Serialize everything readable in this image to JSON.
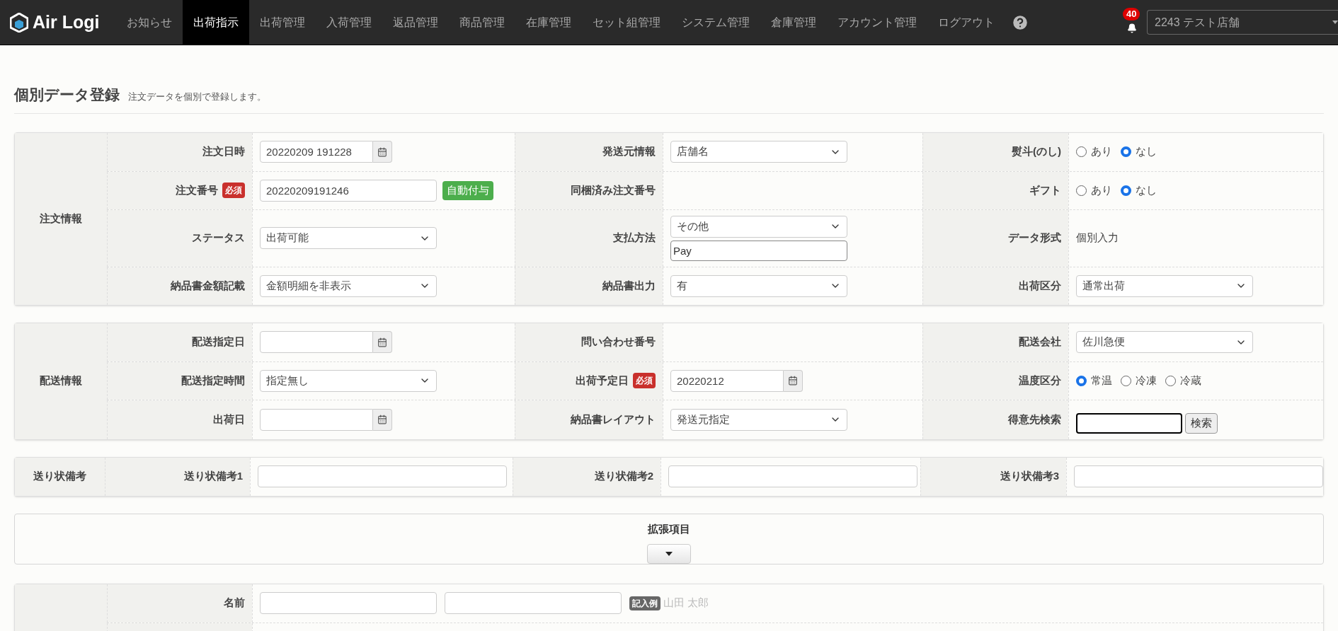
{
  "header": {
    "logo": "Air Logi",
    "nav": [
      {
        "label": "お知らせ",
        "selected": false
      },
      {
        "label": "出荷指示",
        "selected": true
      },
      {
        "label": "出荷管理",
        "selected": false
      },
      {
        "label": "入荷管理",
        "selected": false
      },
      {
        "label": "返品管理",
        "selected": false
      },
      {
        "label": "商品管理",
        "selected": false
      },
      {
        "label": "在庫管理",
        "selected": false
      },
      {
        "label": "セット組管理",
        "selected": false
      },
      {
        "label": "システム管理",
        "selected": false
      },
      {
        "label": "倉庫管理",
        "selected": false
      },
      {
        "label": "アカウント管理",
        "selected": false
      },
      {
        "label": "ログアウト",
        "selected": false
      }
    ],
    "notification_count": "40",
    "store": "2243 テスト店舗"
  },
  "page": {
    "title": "個別データ登録",
    "subtitle": "注文データを個別で登録します。"
  },
  "sections": [
    {
      "kind": "grid",
      "label": "注文情報",
      "rows": [
        {
          "fields": [
            {
              "label": "注文日時",
              "control": {
                "kind": "date",
                "value": "20220209 191228"
              }
            },
            {
              "label": "発送元情報",
              "control": {
                "kind": "select",
                "value": "店舗名"
              }
            },
            {
              "label": "熨斗(のし)",
              "control": {
                "kind": "radio",
                "options": [
                  {
                    "label": "あり",
                    "selected": false
                  },
                  {
                    "label": "なし",
                    "selected": true
                  }
                ]
              }
            }
          ]
        },
        {
          "fields": [
            {
              "label": "注文番号",
              "badge": "必須",
              "control": {
                "kind": "text",
                "value": "20220209191246",
                "button": "自動付与"
              }
            },
            {
              "label": "同梱済み注文番号",
              "control": {
                "kind": "none"
              }
            },
            {
              "label": "ギフト",
              "control": {
                "kind": "radio",
                "options": [
                  {
                    "label": "あり",
                    "selected": false
                  },
                  {
                    "label": "なし",
                    "selected": true
                  }
                ]
              }
            }
          ]
        },
        {
          "fields": [
            {
              "label": "ステータス",
              "control": {
                "kind": "select",
                "value": "出荷可能"
              }
            },
            {
              "label": "支払方法",
              "control": {
                "kind": "select_text",
                "value": "その他",
                "text": "Pay"
              }
            },
            {
              "label": "データ形式",
              "control": {
                "kind": "static",
                "value": "個別入力"
              }
            }
          ]
        },
        {
          "fields": [
            {
              "label": "納品書金額記載",
              "control": {
                "kind": "select",
                "value": "金額明細を非表示"
              }
            },
            {
              "label": "納品書出力",
              "control": {
                "kind": "select",
                "value": "有"
              }
            },
            {
              "label": "出荷区分",
              "control": {
                "kind": "select",
                "value": "通常出荷"
              }
            }
          ]
        }
      ]
    },
    {
      "kind": "grid",
      "label": "配送情報",
      "rows": [
        {
          "fields": [
            {
              "label": "配送指定日",
              "control": {
                "kind": "date"
              }
            },
            {
              "label": "問い合わせ番号",
              "control": {
                "kind": "none"
              }
            },
            {
              "label": "配送会社",
              "control": {
                "kind": "select",
                "value": "佐川急便"
              }
            }
          ]
        },
        {
          "fields": [
            {
              "label": "配送指定時間",
              "control": {
                "kind": "select",
                "value": "指定無し"
              }
            },
            {
              "label": "出荷予定日",
              "badge": "必須",
              "control": {
                "kind": "date",
                "value": "20220212"
              }
            },
            {
              "label": "温度区分",
              "control": {
                "kind": "radio",
                "options": [
                  {
                    "label": "常温",
                    "selected": true
                  },
                  {
                    "label": "冷凍",
                    "selected": false
                  },
                  {
                    "label": "冷蔵",
                    "selected": false
                  }
                ]
              }
            }
          ]
        },
        {
          "fields": [
            {
              "label": "出荷日",
              "control": {
                "kind": "date"
              }
            },
            {
              "label": "納品書レイアウト",
              "control": {
                "kind": "select",
                "value": "発送元指定"
              }
            },
            {
              "label": "得意先検索",
              "control": {
                "kind": "search",
                "button": "検索"
              }
            }
          ]
        }
      ]
    },
    {
      "kind": "grid",
      "label": "送り状備考",
      "rows": [
        {
          "fields": [
            {
              "label": "送り状備考1",
              "control": {
                "kind": "wide_text"
              }
            },
            {
              "label": "送り状備考2",
              "control": {
                "kind": "wide_text"
              }
            },
            {
              "label": "送り状備考3",
              "control": {
                "kind": "wide_text"
              }
            }
          ]
        }
      ]
    },
    {
      "kind": "expand",
      "title": "拡張項目",
      "expanded": false
    },
    {
      "kind": "grid",
      "rows": [
        {
          "fields": [
            {
              "label": "名前",
              "control": {
                "kind": "name",
                "badge": "記入例",
                "example": "山田 太郎"
              }
            }
          ]
        },
        {
          "fields": []
        }
      ]
    }
  ]
}
